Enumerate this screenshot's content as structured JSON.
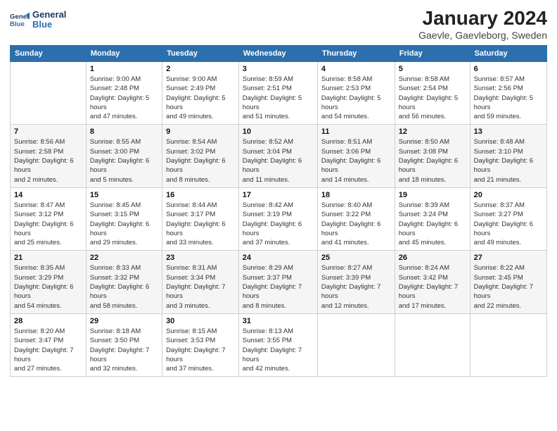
{
  "logo": {
    "line1": "General",
    "line2": "Blue"
  },
  "title": "January 2024",
  "subtitle": "Gaevle, Gaevleborg, Sweden",
  "headers": [
    "Sunday",
    "Monday",
    "Tuesday",
    "Wednesday",
    "Thursday",
    "Friday",
    "Saturday"
  ],
  "weeks": [
    [
      {
        "day": "",
        "sunrise": "",
        "sunset": "",
        "daylight": ""
      },
      {
        "day": "1",
        "sunrise": "Sunrise: 9:00 AM",
        "sunset": "Sunset: 2:48 PM",
        "daylight": "Daylight: 5 hours and 47 minutes."
      },
      {
        "day": "2",
        "sunrise": "Sunrise: 9:00 AM",
        "sunset": "Sunset: 2:49 PM",
        "daylight": "Daylight: 5 hours and 49 minutes."
      },
      {
        "day": "3",
        "sunrise": "Sunrise: 8:59 AM",
        "sunset": "Sunset: 2:51 PM",
        "daylight": "Daylight: 5 hours and 51 minutes."
      },
      {
        "day": "4",
        "sunrise": "Sunrise: 8:58 AM",
        "sunset": "Sunset: 2:53 PM",
        "daylight": "Daylight: 5 hours and 54 minutes."
      },
      {
        "day": "5",
        "sunrise": "Sunrise: 8:58 AM",
        "sunset": "Sunset: 2:54 PM",
        "daylight": "Daylight: 5 hours and 56 minutes."
      },
      {
        "day": "6",
        "sunrise": "Sunrise: 8:57 AM",
        "sunset": "Sunset: 2:56 PM",
        "daylight": "Daylight: 5 hours and 59 minutes."
      }
    ],
    [
      {
        "day": "7",
        "sunrise": "Sunrise: 8:56 AM",
        "sunset": "Sunset: 2:58 PM",
        "daylight": "Daylight: 6 hours and 2 minutes."
      },
      {
        "day": "8",
        "sunrise": "Sunrise: 8:55 AM",
        "sunset": "Sunset: 3:00 PM",
        "daylight": "Daylight: 6 hours and 5 minutes."
      },
      {
        "day": "9",
        "sunrise": "Sunrise: 8:54 AM",
        "sunset": "Sunset: 3:02 PM",
        "daylight": "Daylight: 6 hours and 8 minutes."
      },
      {
        "day": "10",
        "sunrise": "Sunrise: 8:52 AM",
        "sunset": "Sunset: 3:04 PM",
        "daylight": "Daylight: 6 hours and 11 minutes."
      },
      {
        "day": "11",
        "sunrise": "Sunrise: 8:51 AM",
        "sunset": "Sunset: 3:06 PM",
        "daylight": "Daylight: 6 hours and 14 minutes."
      },
      {
        "day": "12",
        "sunrise": "Sunrise: 8:50 AM",
        "sunset": "Sunset: 3:08 PM",
        "daylight": "Daylight: 6 hours and 18 minutes."
      },
      {
        "day": "13",
        "sunrise": "Sunrise: 8:48 AM",
        "sunset": "Sunset: 3:10 PM",
        "daylight": "Daylight: 6 hours and 21 minutes."
      }
    ],
    [
      {
        "day": "14",
        "sunrise": "Sunrise: 8:47 AM",
        "sunset": "Sunset: 3:12 PM",
        "daylight": "Daylight: 6 hours and 25 minutes."
      },
      {
        "day": "15",
        "sunrise": "Sunrise: 8:45 AM",
        "sunset": "Sunset: 3:15 PM",
        "daylight": "Daylight: 6 hours and 29 minutes."
      },
      {
        "day": "16",
        "sunrise": "Sunrise: 8:44 AM",
        "sunset": "Sunset: 3:17 PM",
        "daylight": "Daylight: 6 hours and 33 minutes."
      },
      {
        "day": "17",
        "sunrise": "Sunrise: 8:42 AM",
        "sunset": "Sunset: 3:19 PM",
        "daylight": "Daylight: 6 hours and 37 minutes."
      },
      {
        "day": "18",
        "sunrise": "Sunrise: 8:40 AM",
        "sunset": "Sunset: 3:22 PM",
        "daylight": "Daylight: 6 hours and 41 minutes."
      },
      {
        "day": "19",
        "sunrise": "Sunrise: 8:39 AM",
        "sunset": "Sunset: 3:24 PM",
        "daylight": "Daylight: 6 hours and 45 minutes."
      },
      {
        "day": "20",
        "sunrise": "Sunrise: 8:37 AM",
        "sunset": "Sunset: 3:27 PM",
        "daylight": "Daylight: 6 hours and 49 minutes."
      }
    ],
    [
      {
        "day": "21",
        "sunrise": "Sunrise: 8:35 AM",
        "sunset": "Sunset: 3:29 PM",
        "daylight": "Daylight: 6 hours and 54 minutes."
      },
      {
        "day": "22",
        "sunrise": "Sunrise: 8:33 AM",
        "sunset": "Sunset: 3:32 PM",
        "daylight": "Daylight: 6 hours and 58 minutes."
      },
      {
        "day": "23",
        "sunrise": "Sunrise: 8:31 AM",
        "sunset": "Sunset: 3:34 PM",
        "daylight": "Daylight: 7 hours and 3 minutes."
      },
      {
        "day": "24",
        "sunrise": "Sunrise: 8:29 AM",
        "sunset": "Sunset: 3:37 PM",
        "daylight": "Daylight: 7 hours and 8 minutes."
      },
      {
        "day": "25",
        "sunrise": "Sunrise: 8:27 AM",
        "sunset": "Sunset: 3:39 PM",
        "daylight": "Daylight: 7 hours and 12 minutes."
      },
      {
        "day": "26",
        "sunrise": "Sunrise: 8:24 AM",
        "sunset": "Sunset: 3:42 PM",
        "daylight": "Daylight: 7 hours and 17 minutes."
      },
      {
        "day": "27",
        "sunrise": "Sunrise: 8:22 AM",
        "sunset": "Sunset: 3:45 PM",
        "daylight": "Daylight: 7 hours and 22 minutes."
      }
    ],
    [
      {
        "day": "28",
        "sunrise": "Sunrise: 8:20 AM",
        "sunset": "Sunset: 3:47 PM",
        "daylight": "Daylight: 7 hours and 27 minutes."
      },
      {
        "day": "29",
        "sunrise": "Sunrise: 8:18 AM",
        "sunset": "Sunset: 3:50 PM",
        "daylight": "Daylight: 7 hours and 32 minutes."
      },
      {
        "day": "30",
        "sunrise": "Sunrise: 8:15 AM",
        "sunset": "Sunset: 3:53 PM",
        "daylight": "Daylight: 7 hours and 37 minutes."
      },
      {
        "day": "31",
        "sunrise": "Sunrise: 8:13 AM",
        "sunset": "Sunset: 3:55 PM",
        "daylight": "Daylight: 7 hours and 42 minutes."
      },
      {
        "day": "",
        "sunrise": "",
        "sunset": "",
        "daylight": ""
      },
      {
        "day": "",
        "sunrise": "",
        "sunset": "",
        "daylight": ""
      },
      {
        "day": "",
        "sunrise": "",
        "sunset": "",
        "daylight": ""
      }
    ]
  ]
}
